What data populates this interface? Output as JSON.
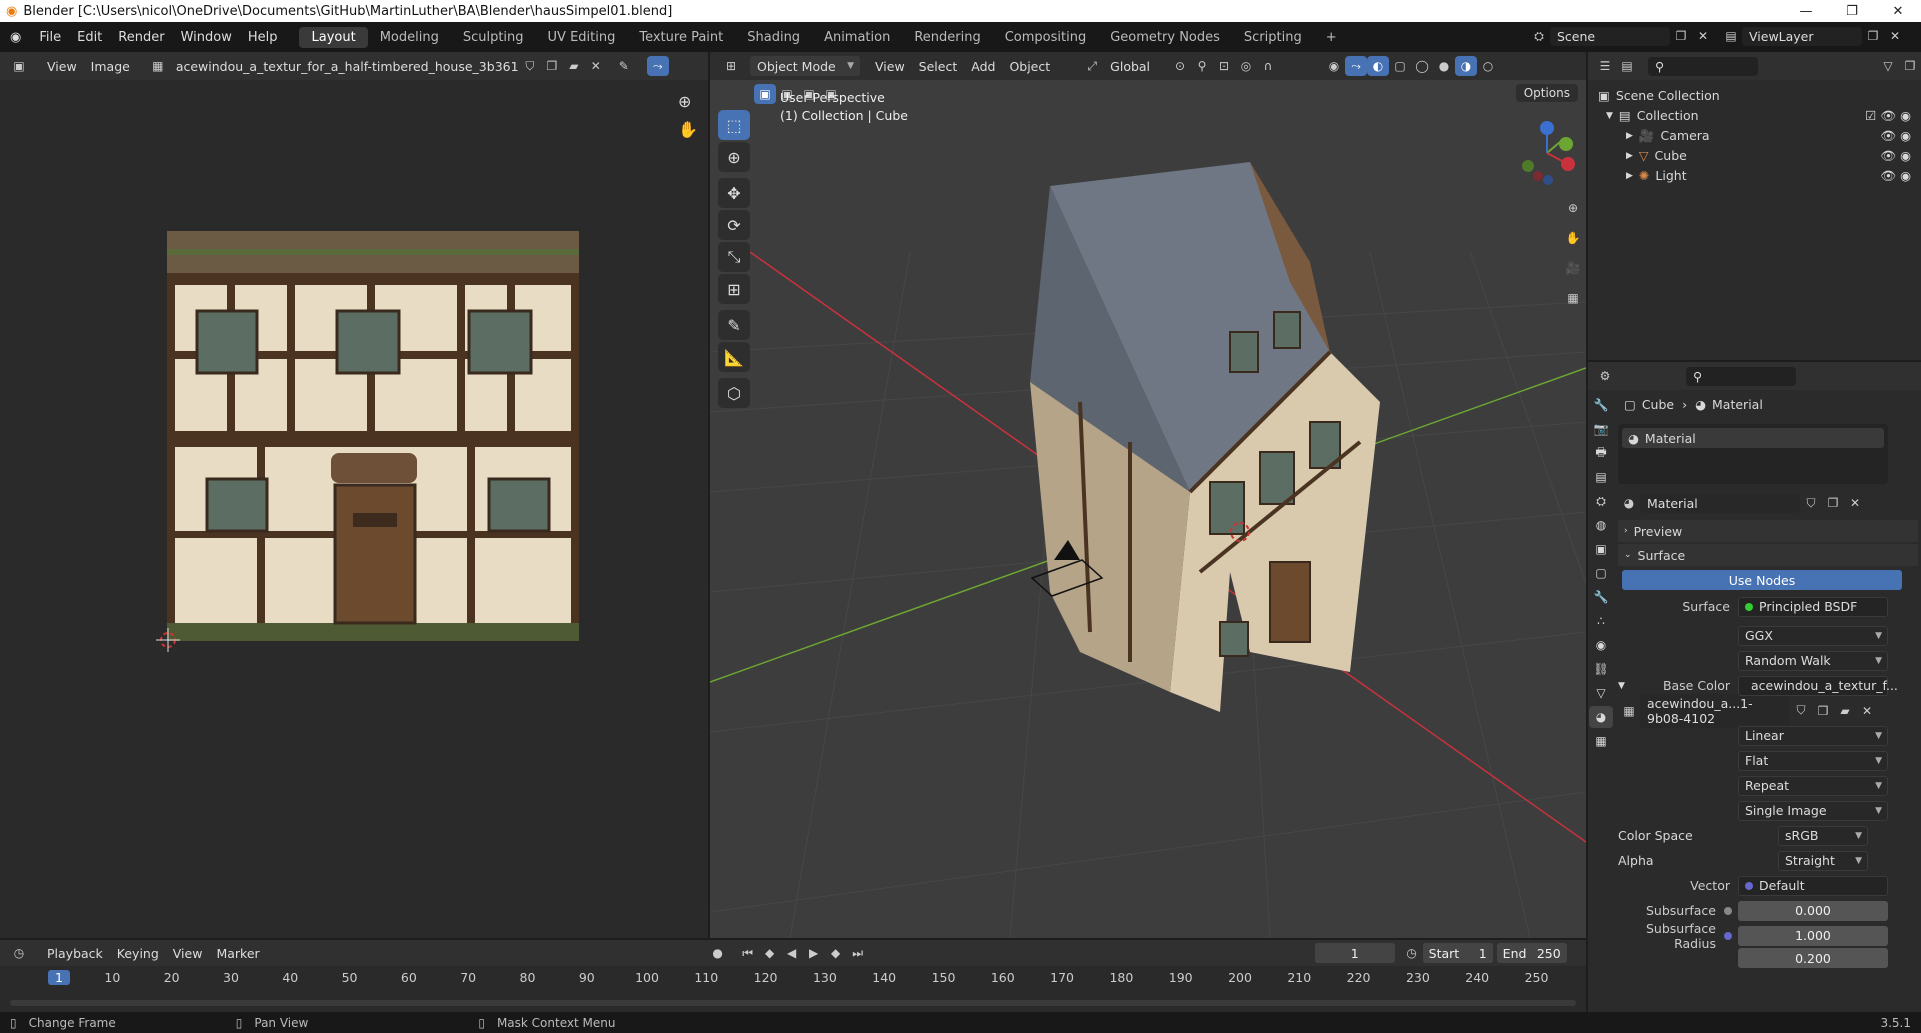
{
  "window": {
    "title": "Blender [C:\\Users\\nicol\\OneDrive\\Documents\\GitHub\\MartinLuther\\BA\\Blender\\hausSimpel01.blend]",
    "minimize": "—",
    "maximize": "❐",
    "close": "✕"
  },
  "menu": [
    "File",
    "Edit",
    "Render",
    "Window",
    "Help"
  ],
  "workspaces": [
    "Layout",
    "Modeling",
    "Sculpting",
    "UV Editing",
    "Texture Paint",
    "Shading",
    "Animation",
    "Rendering",
    "Compositing",
    "Geometry Nodes",
    "Scripting",
    "+"
  ],
  "scene": {
    "scene_name": "Scene",
    "view_layer": "ViewLayer"
  },
  "image_editor": {
    "view": "View",
    "image": "Image",
    "image_name": "acewindou_a_textur_for_a_half-timbered_house_3b361b91-9b08-4..."
  },
  "viewport": {
    "mode": "Object Mode",
    "menus": [
      "View",
      "Select",
      "Add",
      "Object"
    ],
    "orientation": "Global",
    "options": "Options",
    "perspective": "User Perspective",
    "collection_info": "(1) Collection | Cube"
  },
  "outliner": {
    "root": "Scene Collection",
    "collection": "Collection",
    "items": [
      "Camera",
      "Cube",
      "Light"
    ]
  },
  "properties": {
    "breadcrumb_object": "Cube",
    "breadcrumb_material": "Material",
    "slot": "Material",
    "material_name": "Material",
    "preview": "Preview",
    "surface": "Surface",
    "use_nodes": "Use Nodes",
    "surface_label": "Surface",
    "surface_value": "Principled BSDF",
    "distribution": "GGX",
    "subsurface_method": "Random Walk",
    "base_color_label": "Base Color",
    "base_color_value": "acewindou_a_textur_f...",
    "image_name": "acewindou_a...1-9b08-4102",
    "interpolation": "Linear",
    "projection": "Flat",
    "extension": "Repeat",
    "source": "Single Image",
    "color_space_label": "Color Space",
    "color_space": "sRGB",
    "alpha_label": "Alpha",
    "alpha": "Straight",
    "vector_label": "Vector",
    "vector": "Default",
    "subsurface_label": "Subsurface",
    "subsurface": "0.000",
    "subsurface_radius_label": "Subsurface Radius",
    "radius_1": "1.000",
    "radius_2": "0.200"
  },
  "timeline": {
    "menus": [
      "Playback",
      "Keying",
      "View",
      "Marker"
    ],
    "current_frame": "1",
    "start_label": "Start",
    "start": "1",
    "end_label": "End",
    "end": "250",
    "ticks": [
      "1",
      "10",
      "20",
      "30",
      "40",
      "50",
      "60",
      "70",
      "80",
      "90",
      "100",
      "110",
      "120",
      "130",
      "140",
      "150",
      "160",
      "170",
      "180",
      "190",
      "200",
      "210",
      "220",
      "230",
      "240",
      "250"
    ]
  },
  "status": {
    "left": "Change Frame",
    "middle": "Pan View",
    "right": "Mask Context Menu",
    "version": "3.5.1"
  },
  "colors": {
    "accent": "#4772b3",
    "bg": "#1d1d1d",
    "header": "#303030",
    "panel": "#2b2b2b",
    "viewport": "#3d3d3d",
    "x_axis": "#c9323d",
    "y_axis": "#6ca632"
  }
}
